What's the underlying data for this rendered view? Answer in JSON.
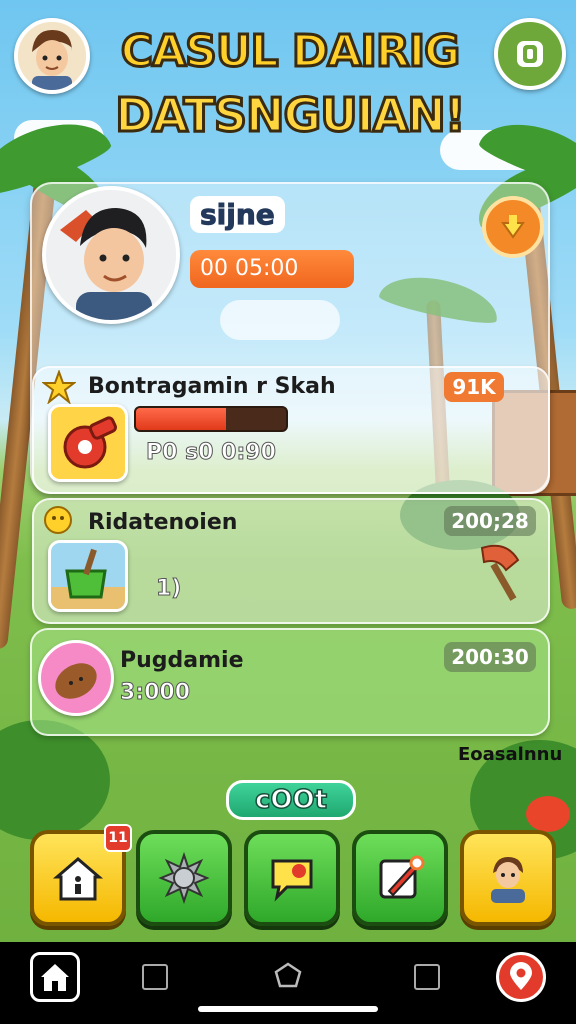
{
  "header": {
    "title_line1": "CASUL DAIRIG",
    "title_line2": "DATSNGUIAN!",
    "avatar_icon": "player-avatar-icon",
    "top_right_icon": "shield-icon"
  },
  "profile": {
    "name": "sijne",
    "timer": "00 05:00",
    "badge_icon": "arrow-down-icon"
  },
  "rows": [
    {
      "title": "Bontragamin r Skah",
      "badge": "91K",
      "progress_fraction": 0.6,
      "sub": "P0 s0 0:90",
      "thumb_icon": "whistle-icon"
    },
    {
      "title": "Ridatenoien",
      "badge": "200;28",
      "sub": "1)",
      "thumb_icon": "watering-can-icon",
      "side_icon": "axe-icon"
    },
    {
      "title": "Pugdamie",
      "badge": "200:30",
      "sub": "3:000",
      "thumb_icon": "bread-icon"
    }
  ],
  "side_tag": "Eoasalnnu",
  "coot_label": "cOOt",
  "bottom_nav": {
    "badge_count": "11",
    "items": [
      {
        "icon": "house-icon"
      },
      {
        "icon": "spike-ball-icon"
      },
      {
        "icon": "chat-bubble-icon"
      },
      {
        "icon": "pencil-icon"
      },
      {
        "icon": "character-icon"
      }
    ]
  },
  "colors": {
    "accent_orange": "#f0661e",
    "nav_green": "#2fa82a",
    "nav_yellow": "#f5b800"
  }
}
